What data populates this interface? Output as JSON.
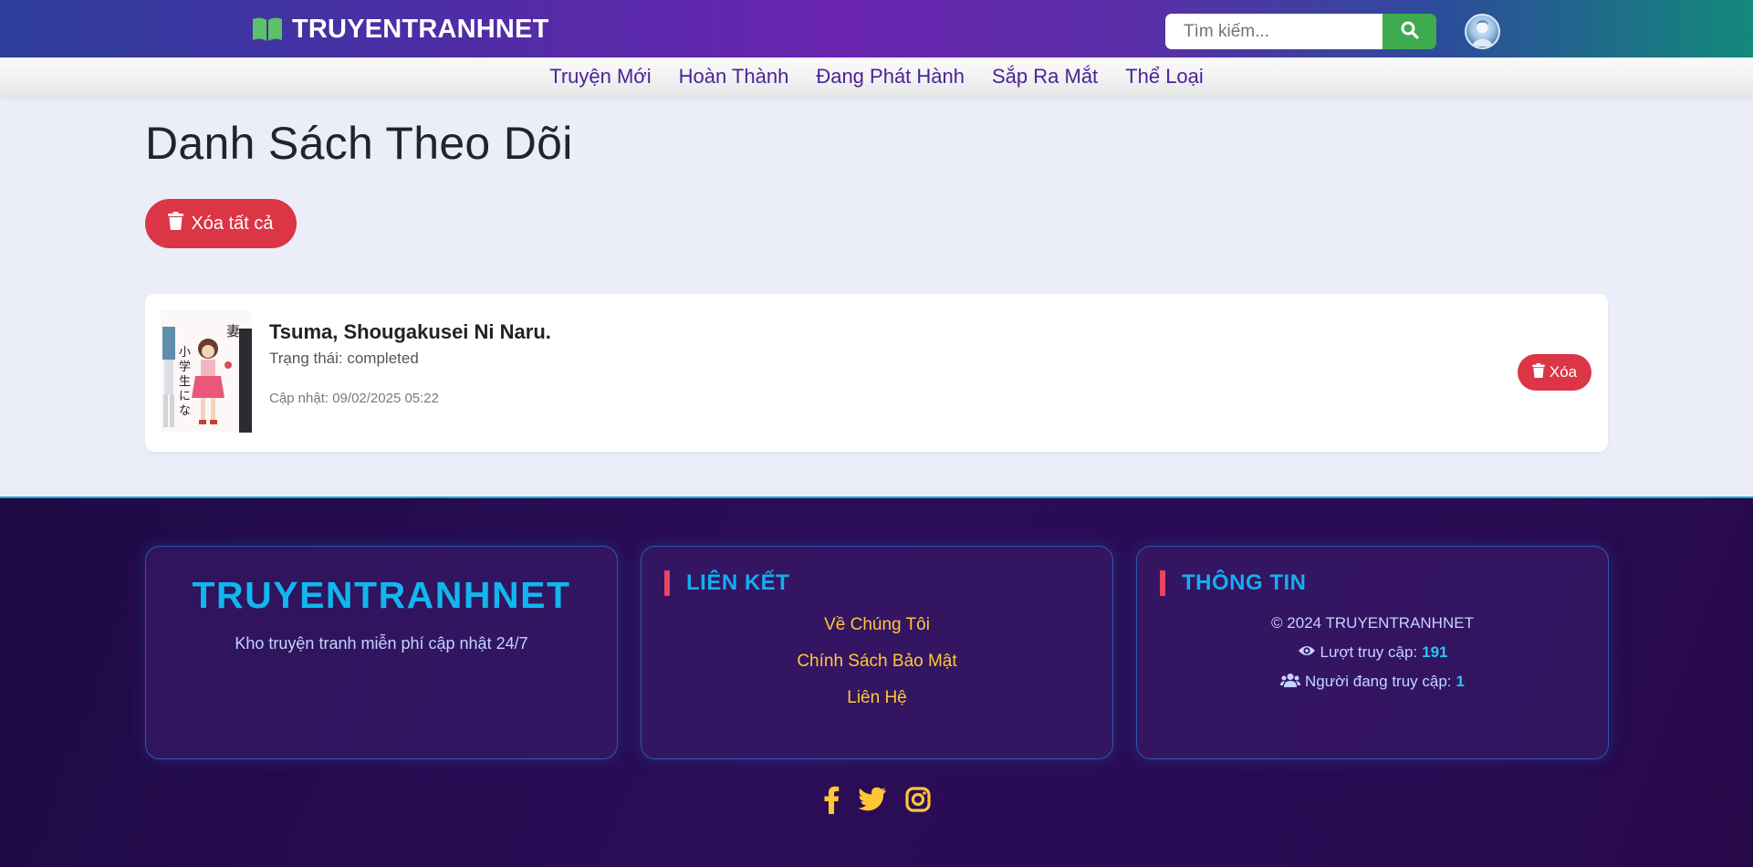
{
  "header": {
    "brand": "TRUYENTRANHNET",
    "search_placeholder": "Tìm kiếm..."
  },
  "nav": {
    "items": [
      "Truyện Mới",
      "Hoàn Thành",
      "Đang Phát Hành",
      "Sắp Ra Mắt",
      "Thể Loại"
    ]
  },
  "main": {
    "title": "Danh Sách Theo Dõi",
    "clear_all_label": "Xóa tất cả",
    "items": [
      {
        "title": "Tsuma, Shougakusei Ni Naru.",
        "status": "Trạng thái: completed",
        "updated": "Cập nhật: 09/02/2025 05:22",
        "remove_label": "Xóa"
      }
    ]
  },
  "footer": {
    "brand": "TRUYENTRANHNET",
    "tagline": "Kho truyện tranh miễn phí cập nhật 24/7",
    "links_heading": "LIÊN KẾT",
    "links": [
      "Về Chúng Tôi",
      "Chính Sách Bảo Mật",
      "Liên Hệ"
    ],
    "info_heading": "THÔNG TIN",
    "copyright": "© 2024 TRUYENTRANHNET",
    "visits_label": "Lượt truy cập:",
    "visits_value": "191",
    "online_label": "Người đang truy cập:",
    "online_value": "1",
    "social_icons": [
      "facebook-icon",
      "twitter-icon",
      "instagram-icon"
    ]
  },
  "colors": {
    "accent_green": "#3eab4f",
    "danger": "#dc3545",
    "footer_brand": "#12b6ee",
    "link_yellow": "#ffc735"
  }
}
